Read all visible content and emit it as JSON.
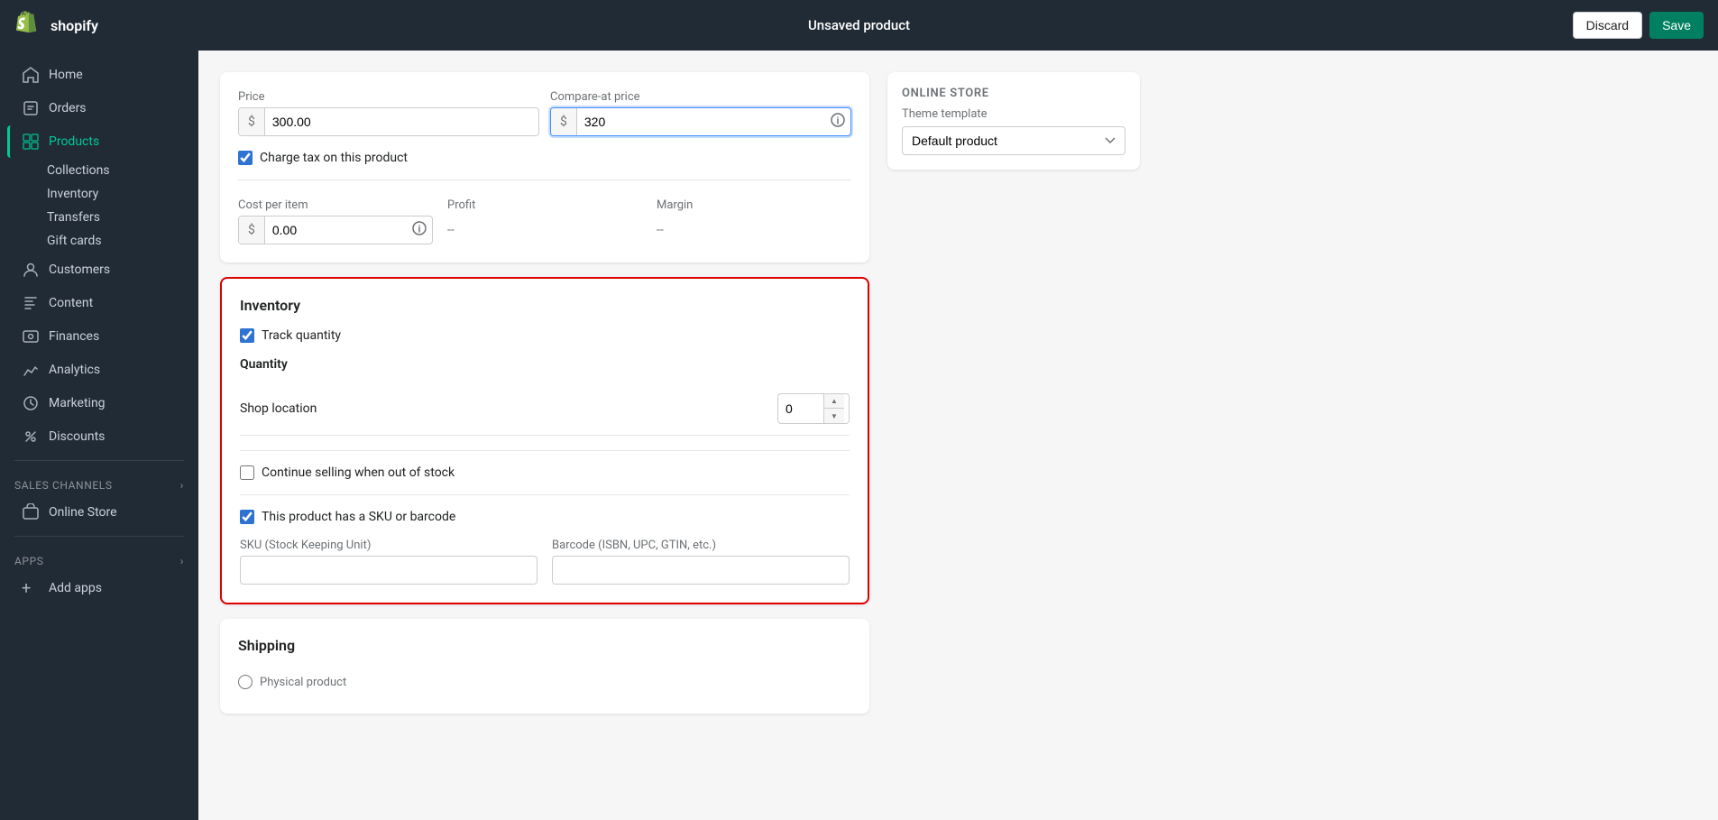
{
  "topbar": {
    "title": "Unsaved product",
    "discard_label": "Discard",
    "save_label": "Save",
    "logo_text": "shopify"
  },
  "sidebar": {
    "home_label": "Home",
    "orders_label": "Orders",
    "products_label": "Products",
    "sub_items": [
      {
        "label": "Collections",
        "active": false
      },
      {
        "label": "Inventory",
        "active": false
      },
      {
        "label": "Transfers",
        "active": false
      },
      {
        "label": "Gift cards",
        "active": false
      }
    ],
    "customers_label": "Customers",
    "content_label": "Content",
    "finances_label": "Finances",
    "analytics_label": "Analytics",
    "marketing_label": "Marketing",
    "discounts_label": "Discounts",
    "sales_channels_label": "Sales channels",
    "online_store_label": "Online Store",
    "apps_label": "Apps",
    "add_apps_label": "Add apps"
  },
  "pricing": {
    "price_label": "Price",
    "compare_label": "Compare-at price",
    "price_value": "300.00",
    "compare_value": "320",
    "currency_symbol": "$",
    "charge_tax_label": "Charge tax on this product",
    "cost_per_item_label": "Cost per item",
    "profit_label": "Profit",
    "margin_label": "Margin",
    "cost_value": "0.00",
    "profit_value": "--",
    "margin_value": "--"
  },
  "inventory": {
    "section_title": "Inventory",
    "track_quantity_label": "Track quantity",
    "quantity_label": "Quantity",
    "shop_location_label": "Shop location",
    "quantity_value": "0",
    "continue_selling_label": "Continue selling when out of stock",
    "has_sku_label": "This product has a SKU or barcode",
    "sku_label": "SKU (Stock Keeping Unit)",
    "barcode_label": "Barcode (ISBN, UPC, GTIN, etc.)",
    "sku_value": "",
    "barcode_value": ""
  },
  "shipping": {
    "section_title": "Shipping"
  },
  "online_store": {
    "section_title": "Online Store",
    "theme_template_label": "Theme template",
    "theme_placeholder": "Default product"
  }
}
